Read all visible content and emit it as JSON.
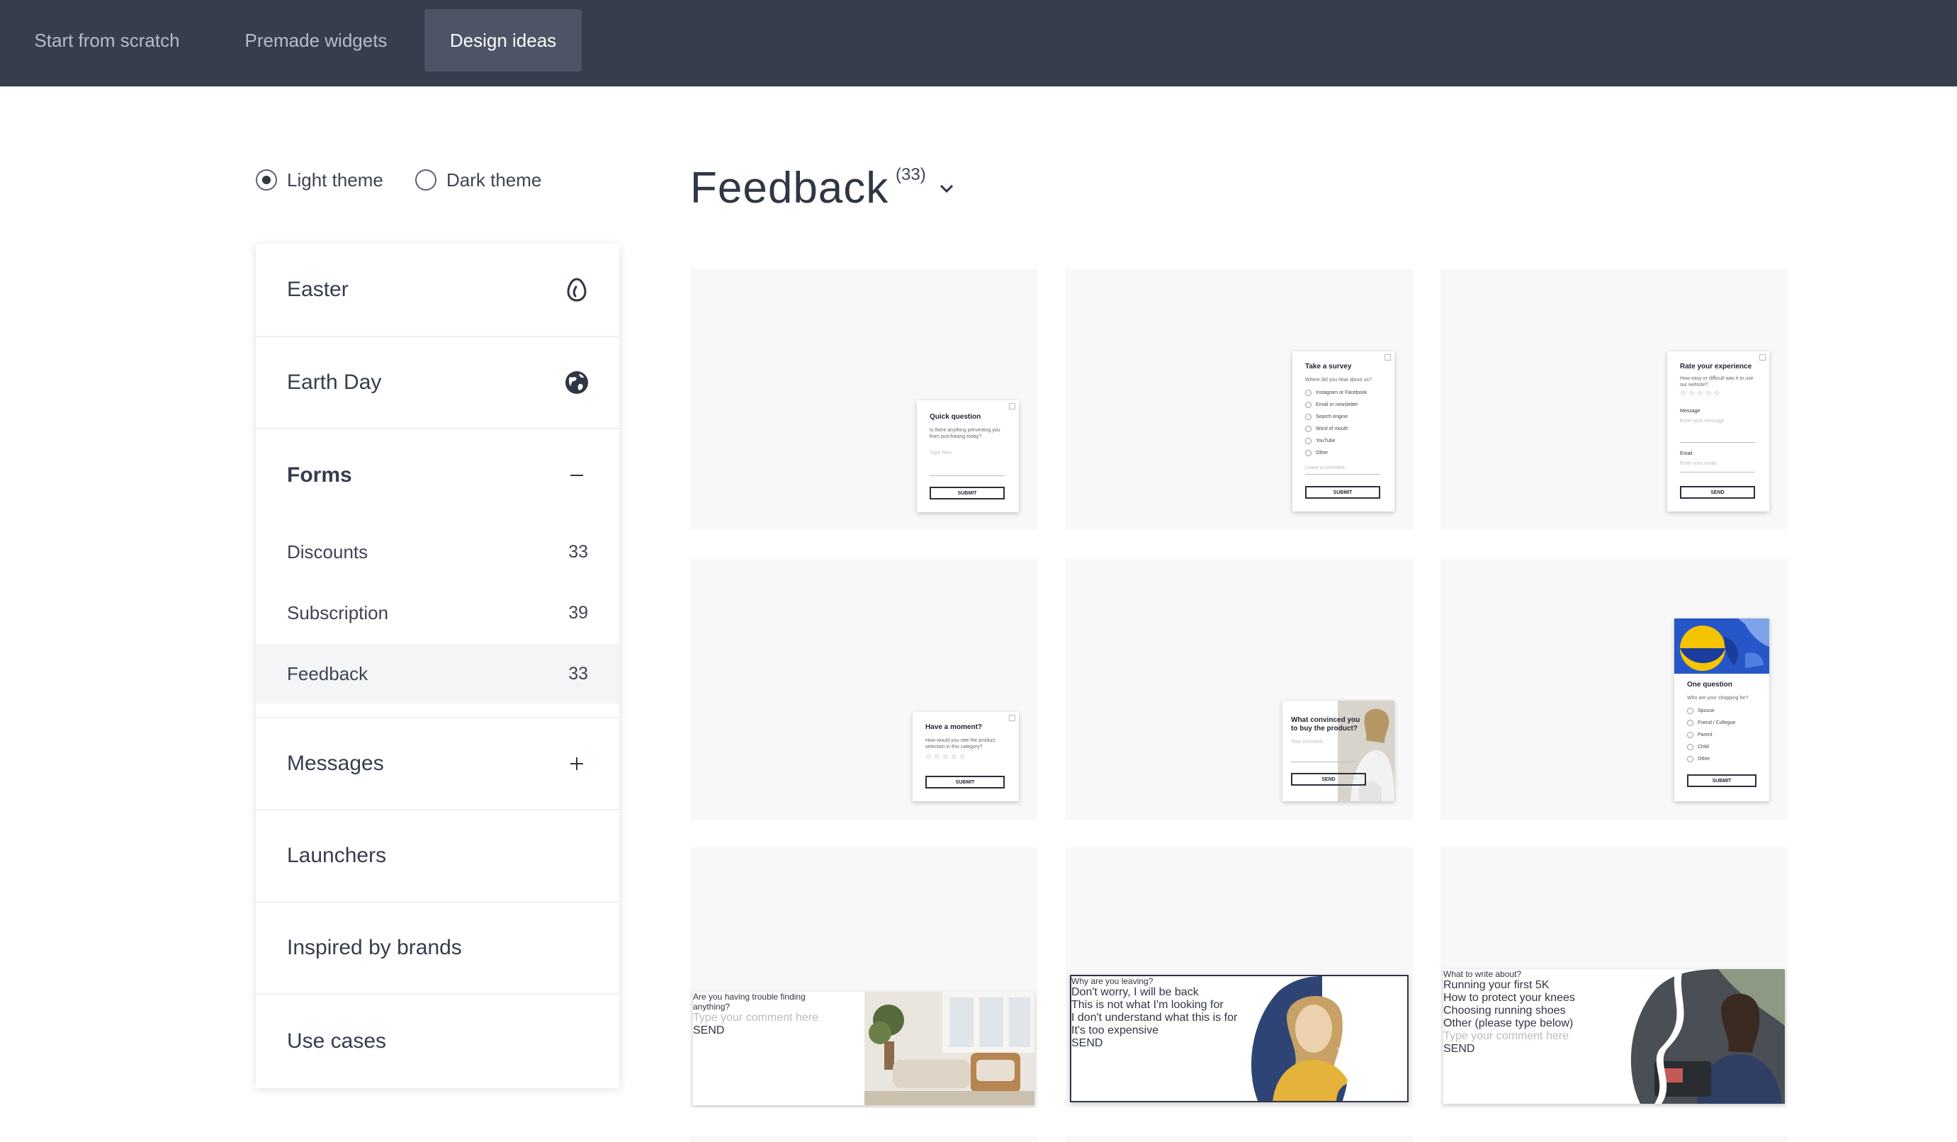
{
  "tabs": [
    {
      "label": "Start from scratch"
    },
    {
      "label": "Premade widgets"
    },
    {
      "label": "Design ideas",
      "active": true
    }
  ],
  "theme": {
    "light": "Light theme",
    "dark": "Dark theme",
    "selected": "light"
  },
  "sidebar": {
    "items": [
      {
        "label": "Easter",
        "icon": "egg-icon"
      },
      {
        "label": "Earth Day",
        "icon": "globe-icon"
      },
      {
        "label": "Forms",
        "icon": "minus-icon",
        "expanded": true
      },
      {
        "label": "Messages",
        "icon": "plus-icon"
      },
      {
        "label": "Launchers"
      },
      {
        "label": "Inspired by brands"
      },
      {
        "label": "Use cases"
      }
    ],
    "forms_sub": [
      {
        "label": "Discounts",
        "count": "33"
      },
      {
        "label": "Subscription",
        "count": "39"
      },
      {
        "label": "Feedback",
        "count": "33",
        "active": true
      }
    ]
  },
  "main": {
    "title": "Feedback",
    "count": "(33)"
  },
  "cards": [
    {
      "title": "Quick question",
      "subtitle": "Is there anything preventing you from purchasing today?",
      "placeholder": "Type here",
      "button": "SUBMIT"
    },
    {
      "title": "Take a survey",
      "subtitle": "Where did you hear about us?",
      "options": [
        "Instagram or Facebook",
        "Email or newsletter",
        "Search engine",
        "Word of mouth",
        "YouTube",
        "Other"
      ],
      "placeholder": "Leave a comment",
      "button": "SUBMIT"
    },
    {
      "title": "Rate your experience",
      "subtitle": "How easy or difficult was it to use our website?",
      "message_label": "Message",
      "message_placeholder": "Enter your message",
      "email_label": "Email",
      "email_placeholder": "Enter your email",
      "button": "SEND"
    },
    {
      "title": "Have a moment?",
      "subtitle": "How would you rate the product selection in this category?",
      "button": "SUBMIT"
    },
    {
      "title": "What convinced you to buy the product?",
      "placeholder": "Your comment",
      "button": "SEND"
    },
    {
      "title": "One question",
      "subtitle": "Who are your shopping for?",
      "options": [
        "Spouse",
        "Friend / Collegue",
        "Parent",
        "Child",
        "Other"
      ],
      "button": "SUBMIT"
    },
    {
      "title": "Are you having trouble finding anything?",
      "placeholder": "Type your comment here",
      "button": "SEND"
    },
    {
      "title": "Why are you leaving?",
      "options": [
        "Don't worry, I will be back",
        "This is not what I'm looking for",
        "I don't understand what this is for",
        "It's too expensive"
      ],
      "button": "SEND"
    },
    {
      "title": "What to write about?",
      "options": [
        "Running your first 5K",
        "How to protect your knees",
        "Choosing running shoes",
        "Other (please type below)"
      ],
      "placeholder": "Type your comment here",
      "button": "SEND"
    }
  ],
  "colors": {
    "topbar": "#363d4d",
    "active_tab": "#4d5466",
    "card_bg": "#f8f8f8",
    "text": "#2f3644"
  }
}
